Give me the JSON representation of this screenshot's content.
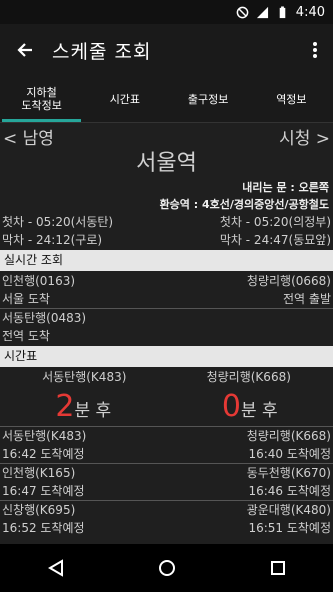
{
  "status": {
    "time": "4:40"
  },
  "appbar": {
    "title": "스케줄 조회"
  },
  "tabs": [
    {
      "label_line1": "지하철",
      "label_line2": "도착정보"
    },
    {
      "label": "시간표"
    },
    {
      "label": "출구정보"
    },
    {
      "label": "역정보"
    }
  ],
  "nav": {
    "prev": "< 남영",
    "next": "시청 >"
  },
  "station": {
    "name": "서울역",
    "exit_side": "내리는 문 : 오른쪽",
    "transfer": "환승역 : 4호선/경의중앙선/공항철도"
  },
  "first_train": {
    "left": "첫차 - 05:20(서동탄)",
    "right": "첫차 - 05:20(의정부)"
  },
  "last_train": {
    "left": "막차 - 24:12(구로)",
    "right": "막차 - 24:47(동묘앞)"
  },
  "realtime": {
    "header": "실시간 조회",
    "r1": {
      "left": "인천행(0163)",
      "right": "청량리행(0668)"
    },
    "r2": {
      "left": "서울 도착",
      "right": "전역 출발"
    },
    "r3": {
      "left": "서동탄행(0483)"
    },
    "r4": {
      "left": "전역 도착"
    }
  },
  "timetable": {
    "header": "시간표",
    "next_left_dest": "서동탄행(K483)",
    "next_right_dest": "청량리행(K668)",
    "left_min": "2",
    "right_min": "0",
    "unit": "분 후",
    "rows": [
      {
        "left": "서동탄행(K483)",
        "right": "청량리행(K668)",
        "left_time": "16:42 도착예정",
        "right_time": "16:40 도착예정"
      },
      {
        "left": "인천행(K165)",
        "right": "동두천행(K670)",
        "left_time": "16:47 도착예정",
        "right_time": "16:46 도착예정"
      },
      {
        "left": "신창행(K695)",
        "right": "광운대행(K480)",
        "left_time": "16:52 도착예정",
        "right_time": "16:51 도착예정"
      }
    ]
  },
  "colors": {
    "accent": "#26a69a",
    "countdown": "#e53935"
  }
}
